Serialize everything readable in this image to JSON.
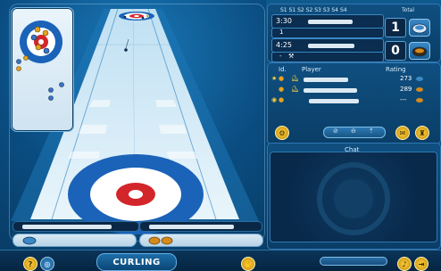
{
  "scoreboard": {
    "ends_header": [
      "S1",
      "S1",
      "S2",
      "S2",
      "S3",
      "S3",
      "S4",
      "S4"
    ],
    "total_label": "Total",
    "team1": {
      "time": "3:30",
      "end_marker": "1",
      "total": "1",
      "stone_color": "#3aa0dc"
    },
    "team2": {
      "time": "4:25",
      "end_marker": "-",
      "total": "0",
      "stone_color": "#d48a1c"
    }
  },
  "players": {
    "headers": {
      "id": "Id.",
      "player": "Player",
      "rating": "Rating"
    },
    "rows": [
      {
        "rating": "273",
        "stone": "blue"
      },
      {
        "rating": "289",
        "stone": "orange"
      },
      {
        "rating": "---",
        "stone": "orange"
      }
    ]
  },
  "chat": {
    "title": "Chat"
  },
  "game": {
    "logo_text": "CURLING"
  },
  "colors": {
    "house_blue": "#1a63b8",
    "house_red": "#d3262a",
    "ice": "#e8f4fb",
    "panel": "#0f4f80"
  },
  "icons": {
    "help": "question-mark-icon",
    "view": "eye-icon",
    "sound": "speaker-icon",
    "exit": "exit-icon",
    "settings": "gear-icon"
  }
}
